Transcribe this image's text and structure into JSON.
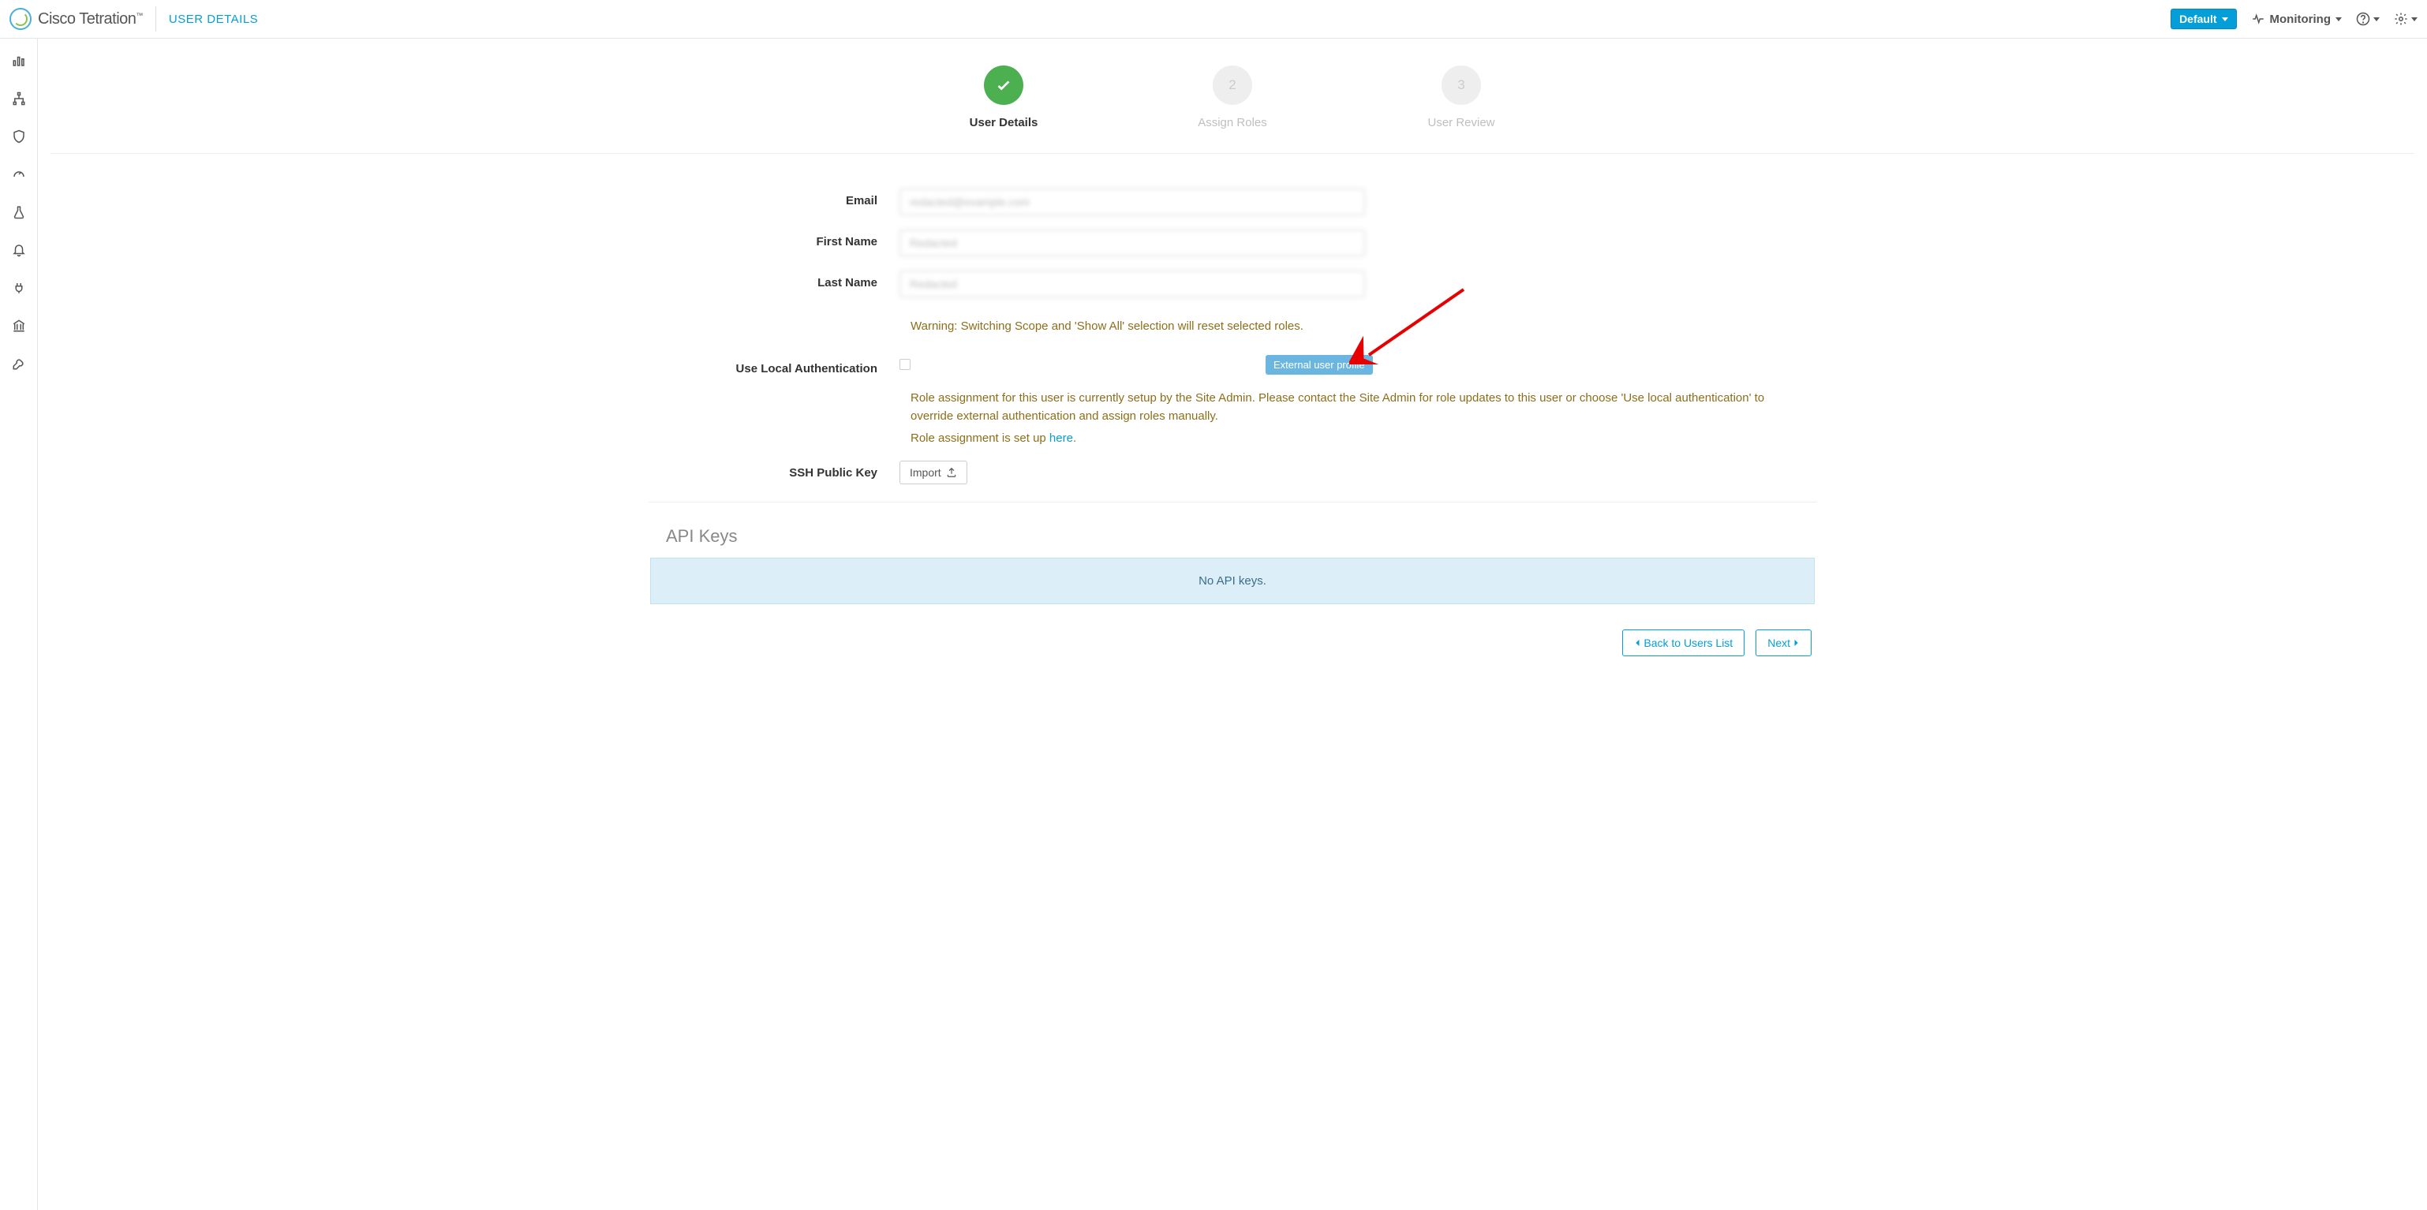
{
  "header": {
    "brand": "Cisco Tetration",
    "page_title": "USER DETAILS",
    "scope_label": "Default",
    "monitoring_label": "Monitoring"
  },
  "stepper": {
    "step1_label": "User Details",
    "step2_num": "2",
    "step2_label": "Assign Roles",
    "step3_num": "3",
    "step3_label": "User Review"
  },
  "form": {
    "email_label": "Email",
    "email_value": "redacted@example.com",
    "first_name_label": "First Name",
    "first_name_value": "Redacted",
    "last_name_label": "Last Name",
    "last_name_value": "Redacted",
    "warning": "Warning: Switching Scope and 'Show All' selection will reset selected roles.",
    "use_local_auth_label": "Use Local Authentication",
    "external_badge": "External user profile",
    "role_info_1": "Role assignment for this user is currently setup by the Site Admin. Please contact the Site Admin for role updates to this user or choose 'Use local authentication' to override external authentication and assign roles manually.",
    "role_info_2_prefix": "Role assignment is set up ",
    "role_info_2_link": "here",
    "role_info_2_suffix": ".",
    "ssh_label": "SSH Public Key",
    "import_btn": "Import"
  },
  "api": {
    "section_title": "API Keys",
    "no_keys": "No API keys."
  },
  "footer": {
    "back": "Back to Users List",
    "next": "Next"
  }
}
